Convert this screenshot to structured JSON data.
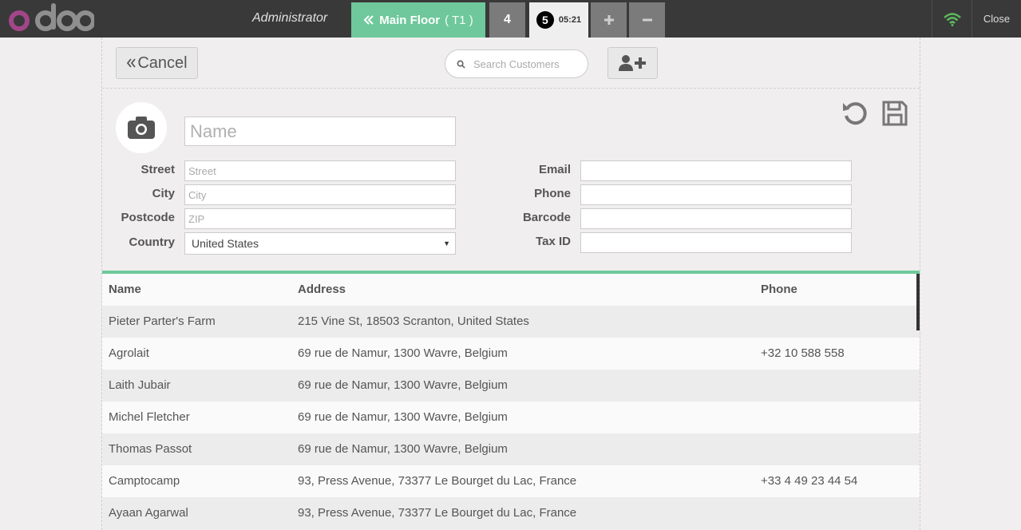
{
  "topbar": {
    "logo_alt": "odoo",
    "user": "Administrator",
    "floor": {
      "label": "Main Floor",
      "table": "( T1 )"
    },
    "orders": [
      {
        "number": "4"
      },
      {
        "number": "5",
        "time": "05:21"
      }
    ],
    "add_icon": "plus-icon",
    "remove_icon": "minus-icon",
    "wifi_icon": "wifi-icon",
    "wifi_color": "#6ec89b",
    "close_label": "Close"
  },
  "header": {
    "cancel_label": "Cancel",
    "search_placeholder": "Search Customers",
    "new_customer_icon": "user-plus-icon"
  },
  "form": {
    "name_placeholder": "Name",
    "labels": {
      "street": "Street",
      "city": "City",
      "postcode": "Postcode",
      "country": "Country",
      "email": "Email",
      "phone": "Phone",
      "barcode": "Barcode",
      "tax_id": "Tax ID"
    },
    "placeholders": {
      "street": "Street",
      "city": "City",
      "postcode": "ZIP"
    },
    "values": {
      "country": "United States",
      "email": "",
      "phone": "",
      "barcode": "",
      "tax_id": ""
    }
  },
  "table": {
    "headers": {
      "name": "Name",
      "address": "Address",
      "phone": "Phone"
    },
    "rows": [
      {
        "name": "Pieter Parter's Farm",
        "address": "215 Vine St, 18503 Scranton, United States",
        "phone": ""
      },
      {
        "name": "Agrolait",
        "address": "69 rue de Namur, 1300 Wavre, Belgium",
        "phone": "+32 10 588 558"
      },
      {
        "name": "Laith Jubair",
        "address": "69 rue de Namur, 1300 Wavre, Belgium",
        "phone": ""
      },
      {
        "name": "Michel Fletcher",
        "address": "69 rue de Namur, 1300 Wavre, Belgium",
        "phone": ""
      },
      {
        "name": "Thomas Passot",
        "address": "69 rue de Namur, 1300 Wavre, Belgium",
        "phone": ""
      },
      {
        "name": "Camptocamp",
        "address": "93, Press Avenue, 73377 Le Bourget du Lac, France",
        "phone": "+33 4 49 23 44 54"
      },
      {
        "name": "Ayaan Agarwal",
        "address": "93, Press Avenue, 73377 Le Bourget du Lac, France",
        "phone": ""
      }
    ]
  },
  "colors": {
    "accent": "#6ec89b",
    "topbar": "#393939"
  }
}
